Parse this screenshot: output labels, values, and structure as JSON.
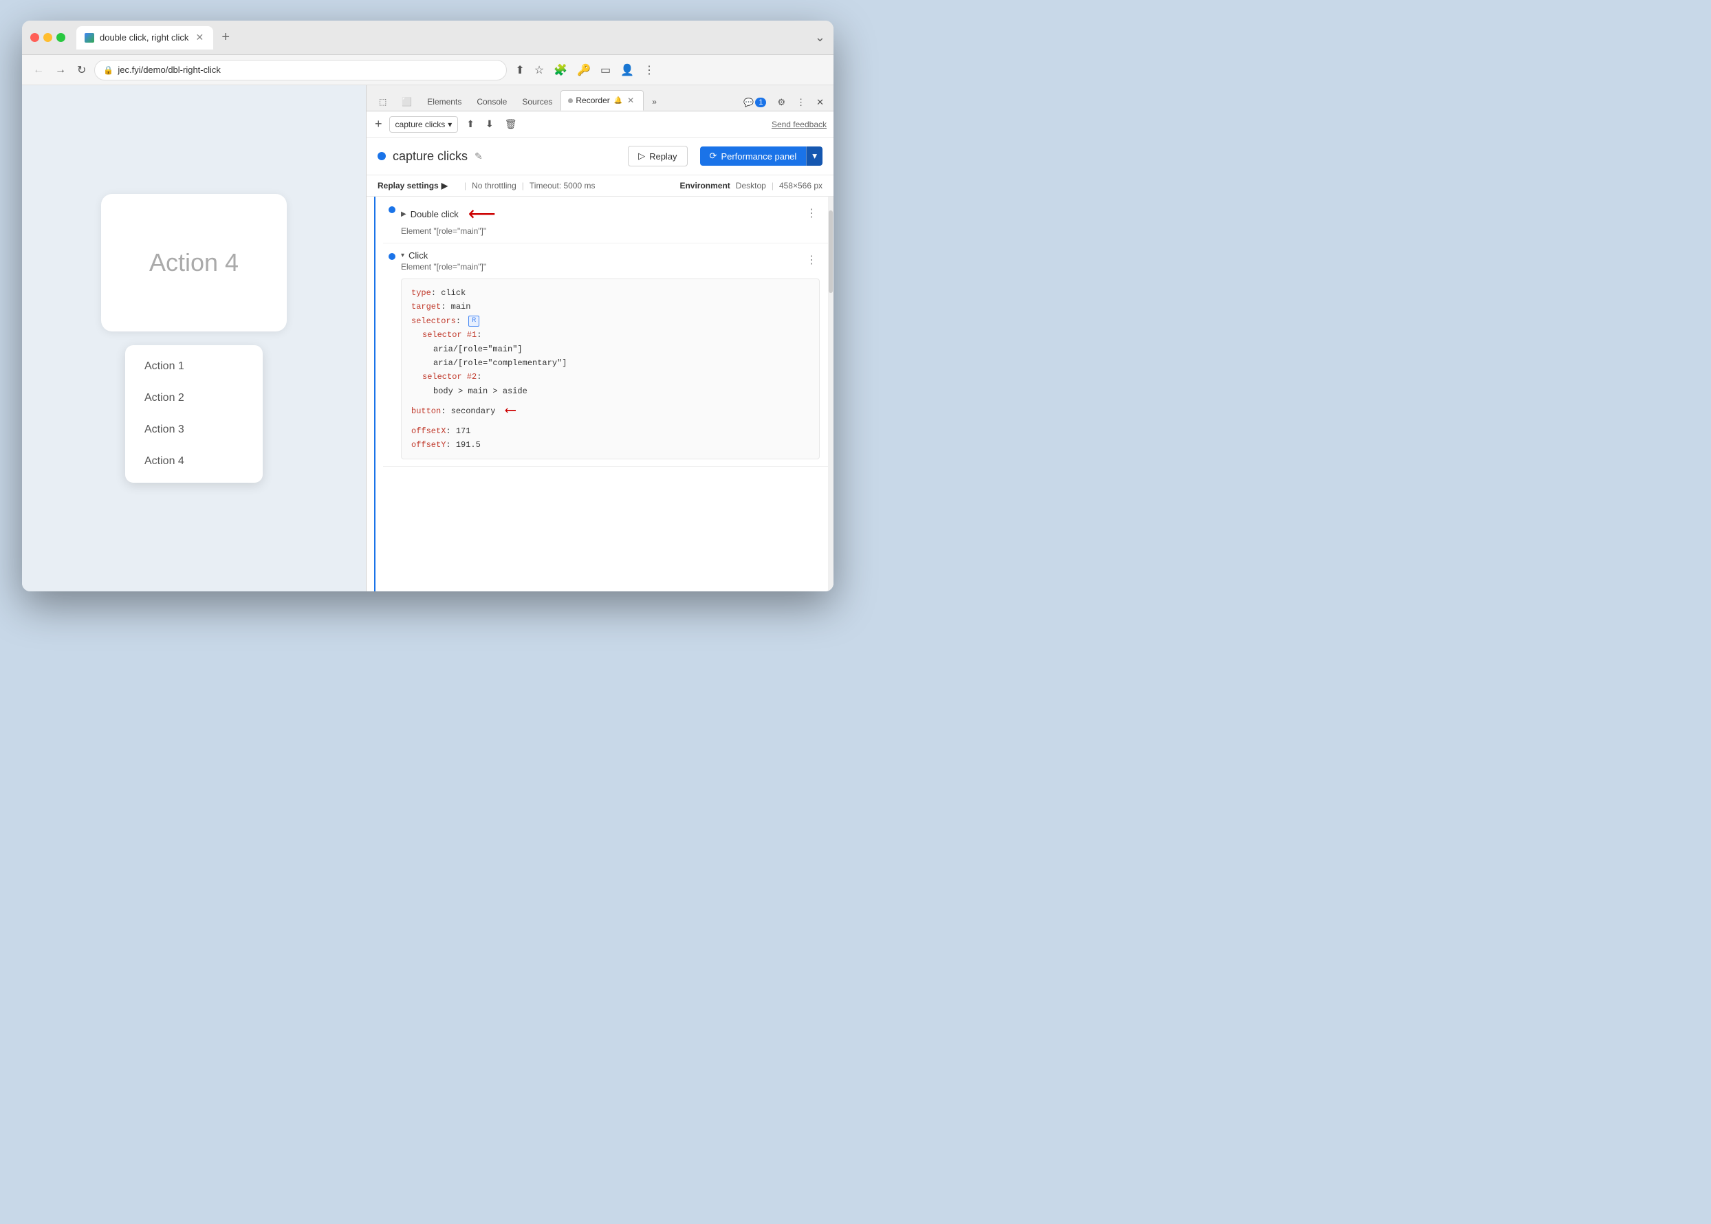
{
  "browser": {
    "tab_title": "double click, right click",
    "url": "jec.fyi/demo/dbl-right-click",
    "new_tab_label": "+"
  },
  "devtools": {
    "tabs": [
      {
        "label": "Elements",
        "active": false
      },
      {
        "label": "Console",
        "active": false
      },
      {
        "label": "Sources",
        "active": false
      },
      {
        "label": "Recorder",
        "active": true
      },
      {
        "label": "»",
        "active": false
      }
    ],
    "badge": "1",
    "toolbar": {
      "add_label": "+",
      "dropdown_label": "capture clicks",
      "send_feedback": "Send feedback"
    },
    "recorder": {
      "title": "capture clicks",
      "replay_label": "Replay",
      "perf_panel_label": "Performance panel"
    },
    "replay_settings": {
      "title": "Replay settings",
      "throttling": "No throttling",
      "timeout": "Timeout: 5000 ms",
      "environment_label": "Environment",
      "desktop": "Desktop",
      "resolution": "458×566 px"
    },
    "actions": [
      {
        "id": 1,
        "type": "Double click",
        "element": "Element \"[role=\"main\"]\"",
        "expanded": false,
        "has_red_arrow": true
      },
      {
        "id": 2,
        "type": "Click",
        "element": "Element \"[role=\"main\"]\"",
        "expanded": true,
        "has_red_arrow": false,
        "code": {
          "lines": [
            {
              "key": "type",
              "val": "click"
            },
            {
              "key": "target",
              "val": "main"
            },
            {
              "key": "selectors",
              "val": "",
              "has_icon": true
            },
            {
              "key": "  selector #1",
              "val": ""
            },
            {
              "key": "    aria/[role=\"main\"]",
              "val": ""
            },
            {
              "key": "    aria/[role=\"complementary\"]",
              "val": ""
            },
            {
              "key": "  selector #2",
              "val": ""
            },
            {
              "key": "    body > main > aside",
              "val": ""
            },
            {
              "key": "button",
              "val": "secondary",
              "has_red_arrow": true
            },
            {
              "key": "offsetX",
              "val": "171"
            },
            {
              "key": "offsetY",
              "val": "191.5"
            }
          ]
        }
      }
    ]
  },
  "page": {
    "main_card_text": "Action 4",
    "dropdown_items": [
      "Action 1",
      "Action 2",
      "Action 3",
      "Action 4"
    ]
  },
  "icons": {
    "back": "←",
    "forward": "→",
    "refresh": "↻",
    "lock": "🔒",
    "share": "⬆",
    "star": "☆",
    "puzzle": "🧩",
    "extension": "🔑",
    "sidebar": "▭",
    "profile": "👤",
    "more": "⋮",
    "expand_more": "▼",
    "chevron_right": "▶",
    "expand_down": "▾",
    "edit": "✎",
    "play": "▷",
    "close": "✕",
    "settings": "⚙",
    "inspect": "⬚",
    "device": "⬜"
  }
}
